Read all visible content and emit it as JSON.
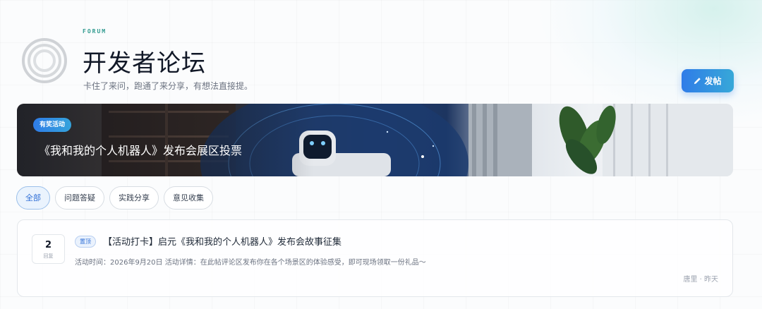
{
  "header": {
    "eyebrow": "FORUM",
    "title": "开发者论坛",
    "subtitle": "卡住了来问，跑通了来分享，有想法直接提。",
    "post_button": "发帖",
    "post_button_icon": "pencil-icon",
    "logo_icon": "concentric-rings-logo"
  },
  "banner": {
    "badge": "有奖活动",
    "title": "《我和我的个人机器人》发布会展区投票"
  },
  "tabs": [
    {
      "label": "全部",
      "active": true
    },
    {
      "label": "问题答疑",
      "active": false
    },
    {
      "label": "实践分享",
      "active": false
    },
    {
      "label": "意见收集",
      "active": false
    }
  ],
  "posts": [
    {
      "reply_count": "2",
      "reply_label": "回复",
      "pin_label": "置顶",
      "title": "【活动打卡】启元《我和我的个人机器人》发布会故事征集",
      "meta": "活动时间：2026年9月20日 活动详情：在此帖评论区发布你在各个场景区的体验感受，即可现场领取一份礼品～",
      "author": "唐里 · 昨天"
    }
  ],
  "colors": {
    "accent": "#2f7ce8",
    "brand_teal": "#2f9a8f"
  }
}
